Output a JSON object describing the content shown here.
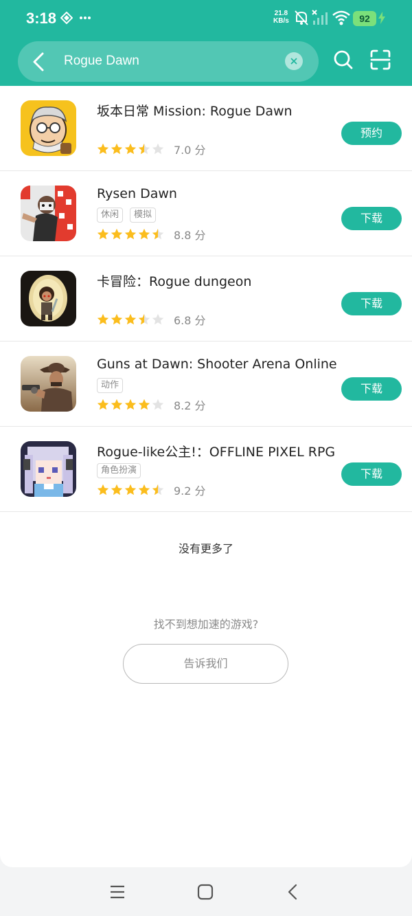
{
  "status_bar": {
    "time": "3:18",
    "net_speed_value": "21.8",
    "net_speed_unit": "KB/s",
    "battery": "92"
  },
  "search": {
    "query": "Rogue Dawn"
  },
  "results": [
    {
      "title": "坂本日常 Mission: Rogue Dawn",
      "tags": [],
      "rating": 3.5,
      "score": "7.0 分",
      "action": "预约",
      "icon": "old-man-cartoon-icon"
    },
    {
      "title": "Rysen Dawn",
      "tags": [
        "休闲",
        "模拟"
      ],
      "rating": 4.5,
      "score": "8.8 分",
      "action": "下载",
      "icon": "masked-runner-icon"
    },
    {
      "title": "卡冒险：Rogue dungeon",
      "tags": [],
      "rating": 3.5,
      "score": "6.8 分",
      "action": "下载",
      "icon": "dungeon-hero-icon"
    },
    {
      "title": "Guns at Dawn: Shooter Arena Online",
      "tags": [
        "动作"
      ],
      "rating": 4,
      "score": "8.2 分",
      "action": "下载",
      "icon": "cowboy-gunslinger-icon"
    },
    {
      "title": "Rogue-like公主!：OFFLINE PIXEL RPG",
      "tags": [
        "角色扮演"
      ],
      "rating": 4.5,
      "score": "9.2 分",
      "action": "下载",
      "icon": "pixel-princess-icon"
    }
  ],
  "no_more_text": "没有更多了",
  "prompt_text": "找不到想加速的游戏?",
  "tell_us_label": "告诉我们",
  "colors": {
    "accent": "#22b89f",
    "star": "#fbbd1d",
    "star_empty": "#e3e3e3"
  }
}
